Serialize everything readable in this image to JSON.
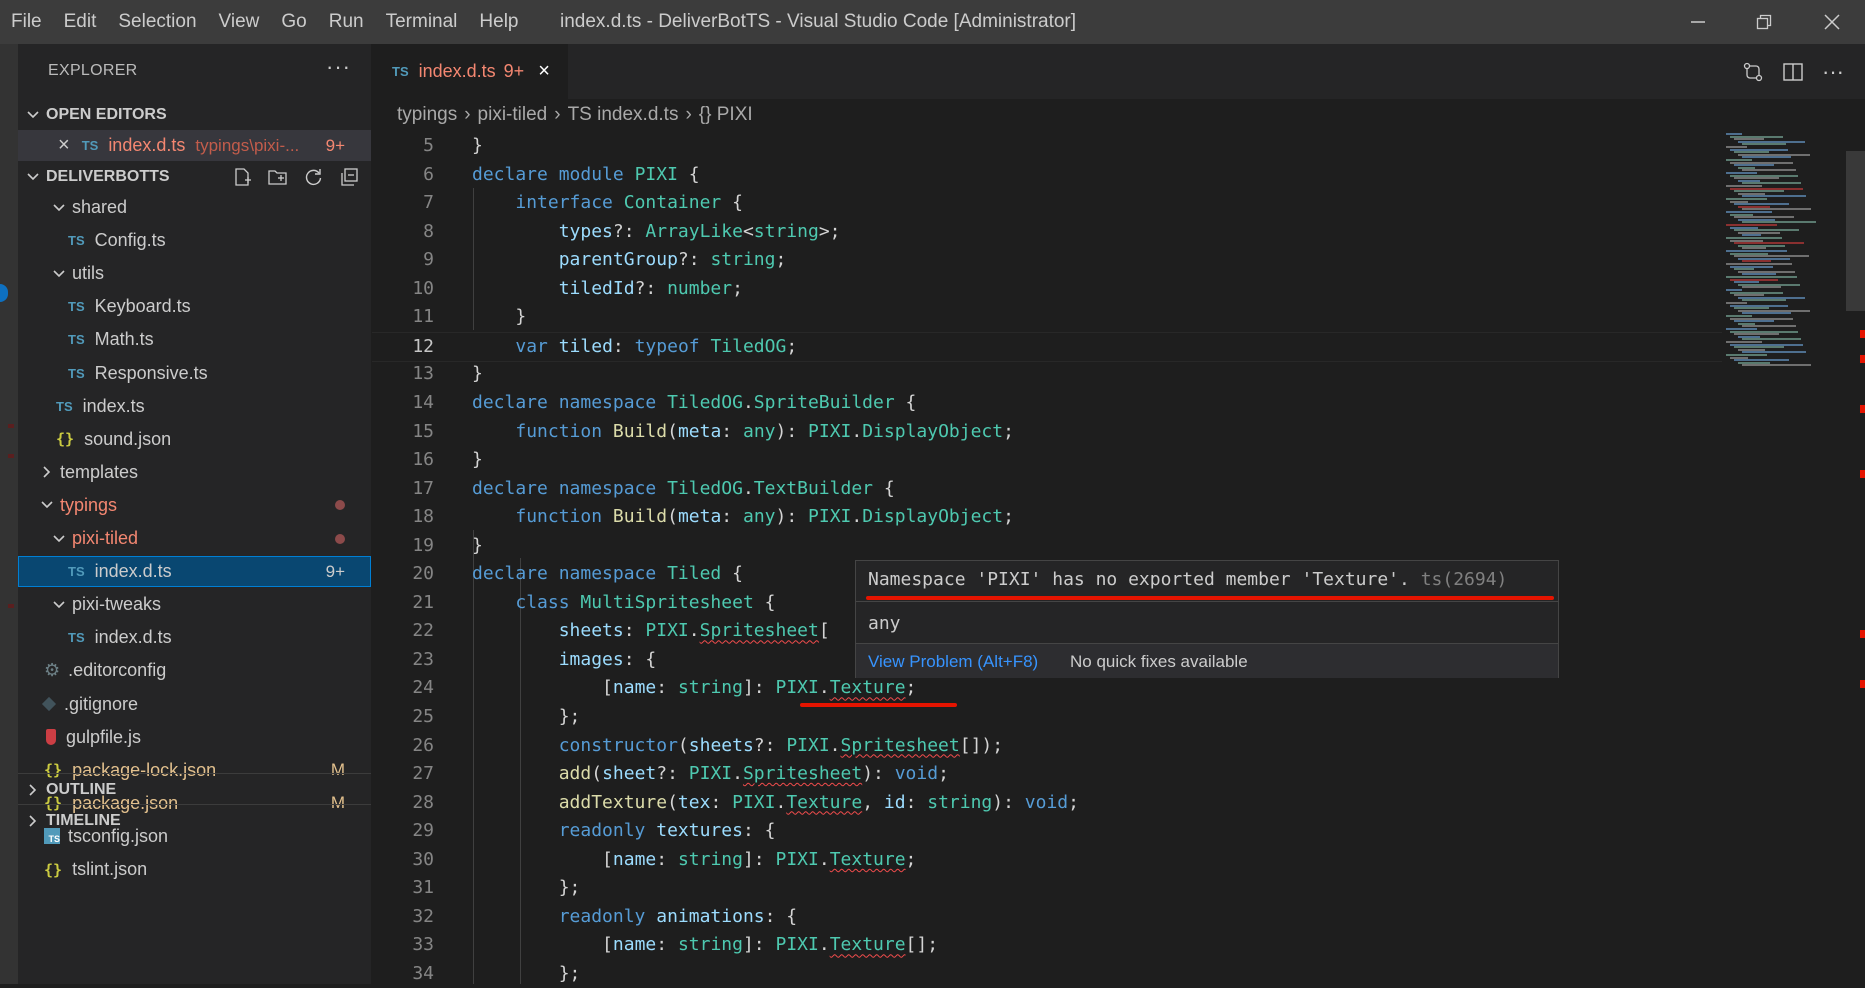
{
  "menu": [
    "File",
    "Edit",
    "Selection",
    "View",
    "Go",
    "Run",
    "Terminal",
    "Help"
  ],
  "window_title": "index.d.ts - DeliverBotTS - Visual Studio Code [Administrator]",
  "window_controls": [
    "minimize-icon",
    "restore-icon",
    "close-icon"
  ],
  "sidebar": {
    "title": "EXPLORER",
    "more": "···",
    "open_editors_label": "OPEN EDITORS",
    "open_editor": {
      "icon": "TS",
      "name": "index.d.ts",
      "path": "typings\\pixi-...",
      "badge": "9+"
    },
    "project_label": "DELIVERBOTTS",
    "tree": [
      {
        "indent": 2,
        "kind": "folder-open",
        "label": "shared"
      },
      {
        "indent": 3,
        "kind": "ts",
        "label": "Config.ts"
      },
      {
        "indent": 2,
        "kind": "folder-open",
        "label": "utils"
      },
      {
        "indent": 3,
        "kind": "ts",
        "label": "Keyboard.ts"
      },
      {
        "indent": 3,
        "kind": "ts",
        "label": "Math.ts"
      },
      {
        "indent": 3,
        "kind": "ts",
        "label": "Responsive.ts"
      },
      {
        "indent": 2,
        "kind": "ts",
        "label": "index.ts"
      },
      {
        "indent": 2,
        "kind": "json",
        "label": "sound.json"
      },
      {
        "indent": 1,
        "kind": "folder-closed",
        "label": "templates"
      },
      {
        "indent": 1,
        "kind": "folder-open",
        "label": "typings",
        "color": "red",
        "dot": true
      },
      {
        "indent": 2,
        "kind": "folder-open",
        "label": "pixi-tiled",
        "color": "red",
        "dot": true
      },
      {
        "indent": 3,
        "kind": "ts",
        "label": "index.d.ts",
        "selected": true,
        "badge": "9+"
      },
      {
        "indent": 2,
        "kind": "folder-open",
        "label": "pixi-tweaks"
      },
      {
        "indent": 3,
        "kind": "ts",
        "label": "index.d.ts"
      },
      {
        "indent": 1,
        "kind": "gear",
        "label": ".editorconfig"
      },
      {
        "indent": 1,
        "kind": "git",
        "label": ".gitignore"
      },
      {
        "indent": 1,
        "kind": "gulp",
        "label": "gulpfile.js"
      },
      {
        "indent": 1,
        "kind": "json",
        "label": "package-lock.json",
        "color": "yellow",
        "badge": "M"
      },
      {
        "indent": 1,
        "kind": "json",
        "label": "package.json",
        "color": "yellow",
        "badge": "M"
      },
      {
        "indent": 1,
        "kind": "tsconfig",
        "label": "tsconfig.json"
      },
      {
        "indent": 1,
        "kind": "json",
        "label": "tslint.json"
      }
    ],
    "outline_label": "OUTLINE",
    "timeline_label": "TIMELINE"
  },
  "tab": {
    "icon": "TS",
    "name": "index.d.ts",
    "count": "9+",
    "close": "×"
  },
  "breadcrumb": [
    "typings",
    "pixi-tiled",
    "TS index.d.ts",
    "{} PIXI"
  ],
  "code_lines": [
    {
      "n": "5",
      "tokens": [
        [
          "}",
          ""
        ]
      ]
    },
    {
      "n": "6",
      "tokens": [
        [
          "declare module ",
          "kw"
        ],
        [
          "PIXI",
          "ty"
        ],
        [
          " {",
          ""
        ]
      ]
    },
    {
      "n": "7",
      "tokens": [
        [
          "    ",
          ""
        ],
        [
          "interface ",
          "kw"
        ],
        [
          "Container",
          "ty"
        ],
        [
          " {",
          ""
        ]
      ]
    },
    {
      "n": "8",
      "tokens": [
        [
          "        ",
          ""
        ],
        [
          "types",
          "pr"
        ],
        [
          "?: ",
          ""
        ],
        [
          "ArrayLike",
          "ty"
        ],
        [
          "<",
          ""
        ],
        [
          "string",
          "ty"
        ],
        [
          ">;",
          ""
        ]
      ]
    },
    {
      "n": "9",
      "tokens": [
        [
          "        ",
          ""
        ],
        [
          "parentGroup",
          "pr"
        ],
        [
          "?: ",
          ""
        ],
        [
          "string",
          "ty"
        ],
        [
          ";",
          ""
        ]
      ]
    },
    {
      "n": "10",
      "tokens": [
        [
          "        ",
          ""
        ],
        [
          "tiledId",
          "pr"
        ],
        [
          "?: ",
          ""
        ],
        [
          "number",
          "ty"
        ],
        [
          ";",
          ""
        ]
      ]
    },
    {
      "n": "11",
      "tokens": [
        [
          "    }",
          ""
        ]
      ]
    },
    {
      "n": "12",
      "active": true,
      "tokens": [
        [
          "    ",
          ""
        ],
        [
          "var ",
          "kw"
        ],
        [
          "tiled",
          "pr"
        ],
        [
          ": ",
          ""
        ],
        [
          "typeof ",
          "kw"
        ],
        [
          "TiledOG",
          "ty"
        ],
        [
          ";",
          ""
        ]
      ]
    },
    {
      "n": "13",
      "tokens": [
        [
          "}",
          ""
        ]
      ]
    },
    {
      "n": "14",
      "tokens": [
        [
          "declare namespace ",
          "kw"
        ],
        [
          "TiledOG",
          "ty"
        ],
        [
          ".",
          ""
        ],
        [
          "SpriteBuilder",
          "ty"
        ],
        [
          " {",
          ""
        ]
      ]
    },
    {
      "n": "15",
      "tokens": [
        [
          "    ",
          ""
        ],
        [
          "function ",
          "kw"
        ],
        [
          "Build",
          "fn"
        ],
        [
          "(",
          ""
        ],
        [
          "meta",
          "pr"
        ],
        [
          ": ",
          ""
        ],
        [
          "any",
          "ty"
        ],
        [
          "): ",
          ""
        ],
        [
          "PIXI",
          "ty"
        ],
        [
          ".",
          ""
        ],
        [
          "DisplayObject",
          "ty"
        ],
        [
          ";",
          ""
        ]
      ]
    },
    {
      "n": "16",
      "tokens": [
        [
          "}",
          ""
        ]
      ]
    },
    {
      "n": "17",
      "tokens": [
        [
          "declare namespace ",
          "kw"
        ],
        [
          "TiledOG",
          "ty"
        ],
        [
          ".",
          ""
        ],
        [
          "TextBuilder",
          "ty"
        ],
        [
          " {",
          ""
        ]
      ]
    },
    {
      "n": "18",
      "tokens": [
        [
          "    ",
          ""
        ],
        [
          "function ",
          "kw"
        ],
        [
          "Build",
          "fn"
        ],
        [
          "(",
          ""
        ],
        [
          "meta",
          "pr"
        ],
        [
          ": ",
          ""
        ],
        [
          "any",
          "ty"
        ],
        [
          "): ",
          ""
        ],
        [
          "PIXI",
          "ty"
        ],
        [
          ".",
          ""
        ],
        [
          "DisplayObject",
          "ty"
        ],
        [
          ";",
          ""
        ]
      ]
    },
    {
      "n": "19",
      "tokens": [
        [
          "}",
          ""
        ]
      ]
    },
    {
      "n": "20",
      "tokens": [
        [
          "declare namespace ",
          "kw"
        ],
        [
          "Tiled",
          "ty"
        ],
        [
          " {",
          ""
        ]
      ]
    },
    {
      "n": "21",
      "tokens": [
        [
          "    ",
          ""
        ],
        [
          "class ",
          "kw"
        ],
        [
          "MultiSpritesheet",
          "ty"
        ],
        [
          " {",
          ""
        ]
      ]
    },
    {
      "n": "22",
      "tokens": [
        [
          "        ",
          ""
        ],
        [
          "sheets",
          "pr"
        ],
        [
          ": ",
          ""
        ],
        [
          "PIXI",
          "ty"
        ],
        [
          ".",
          ""
        ],
        [
          "Spritesheet",
          "ty squig"
        ],
        [
          "[",
          ""
        ]
      ]
    },
    {
      "n": "23",
      "tokens": [
        [
          "        ",
          ""
        ],
        [
          "images",
          "pr"
        ],
        [
          ": {",
          ""
        ]
      ]
    },
    {
      "n": "24",
      "tokens": [
        [
          "            [",
          ""
        ],
        [
          "name",
          "pr"
        ],
        [
          ": ",
          ""
        ],
        [
          "string",
          "ty"
        ],
        [
          "]: ",
          ""
        ],
        [
          "PIXI",
          "ty"
        ],
        [
          ".",
          ""
        ],
        [
          "Texture",
          "ty squig"
        ],
        [
          ";",
          ""
        ]
      ]
    },
    {
      "n": "25",
      "tokens": [
        [
          "        };",
          ""
        ]
      ]
    },
    {
      "n": "26",
      "tokens": [
        [
          "        ",
          ""
        ],
        [
          "constructor",
          "kw"
        ],
        [
          "(",
          ""
        ],
        [
          "sheets",
          "pr"
        ],
        [
          "?: ",
          ""
        ],
        [
          "PIXI",
          "ty"
        ],
        [
          ".",
          ""
        ],
        [
          "Spritesheet",
          "ty squig"
        ],
        [
          "[]);",
          ""
        ]
      ]
    },
    {
      "n": "27",
      "tokens": [
        [
          "        ",
          ""
        ],
        [
          "add",
          "fn"
        ],
        [
          "(",
          ""
        ],
        [
          "sheet",
          "pr"
        ],
        [
          "?: ",
          ""
        ],
        [
          "PIXI",
          "ty"
        ],
        [
          ".",
          ""
        ],
        [
          "Spritesheet",
          "ty squig"
        ],
        [
          "): ",
          ""
        ],
        [
          "void",
          "kw"
        ],
        [
          ";",
          ""
        ]
      ]
    },
    {
      "n": "28",
      "tokens": [
        [
          "        ",
          ""
        ],
        [
          "addTexture",
          "fn"
        ],
        [
          "(",
          ""
        ],
        [
          "tex",
          "pr"
        ],
        [
          ": ",
          ""
        ],
        [
          "PIXI",
          "ty"
        ],
        [
          ".",
          ""
        ],
        [
          "Texture",
          "ty squig"
        ],
        [
          ", ",
          ""
        ],
        [
          "id",
          "pr"
        ],
        [
          ": ",
          ""
        ],
        [
          "string",
          "ty"
        ],
        [
          "): ",
          ""
        ],
        [
          "void",
          "kw"
        ],
        [
          ";",
          ""
        ]
      ]
    },
    {
      "n": "29",
      "tokens": [
        [
          "        ",
          ""
        ],
        [
          "readonly ",
          "kw"
        ],
        [
          "textures",
          "pr"
        ],
        [
          ": {",
          ""
        ]
      ]
    },
    {
      "n": "30",
      "tokens": [
        [
          "            [",
          ""
        ],
        [
          "name",
          "pr"
        ],
        [
          ": ",
          ""
        ],
        [
          "string",
          "ty"
        ],
        [
          "]: ",
          ""
        ],
        [
          "PIXI",
          "ty"
        ],
        [
          ".",
          ""
        ],
        [
          "Texture",
          "ty squig"
        ],
        [
          ";",
          ""
        ]
      ]
    },
    {
      "n": "31",
      "tokens": [
        [
          "        };",
          ""
        ]
      ]
    },
    {
      "n": "32",
      "tokens": [
        [
          "        ",
          ""
        ],
        [
          "readonly ",
          "kw"
        ],
        [
          "animations",
          "pr"
        ],
        [
          ": {",
          ""
        ]
      ]
    },
    {
      "n": "33",
      "tokens": [
        [
          "            [",
          ""
        ],
        [
          "name",
          "pr"
        ],
        [
          ": ",
          ""
        ],
        [
          "string",
          "ty"
        ],
        [
          "]: ",
          ""
        ],
        [
          "PIXI",
          "ty"
        ],
        [
          ".",
          ""
        ],
        [
          "Texture",
          "ty squig"
        ],
        [
          "[];",
          ""
        ]
      ]
    },
    {
      "n": "34",
      "tokens": [
        [
          "        };",
          ""
        ]
      ]
    }
  ],
  "hover": {
    "message": "Namespace 'PIXI' has no exported member 'Texture'.",
    "code": "ts(2694)",
    "type": "any",
    "view_problem": "View Problem (Alt+F8)",
    "no_fix": "No quick fixes available"
  },
  "colors": {
    "accent": "#007fd4",
    "error": "#e51400",
    "selection": "#094771"
  }
}
